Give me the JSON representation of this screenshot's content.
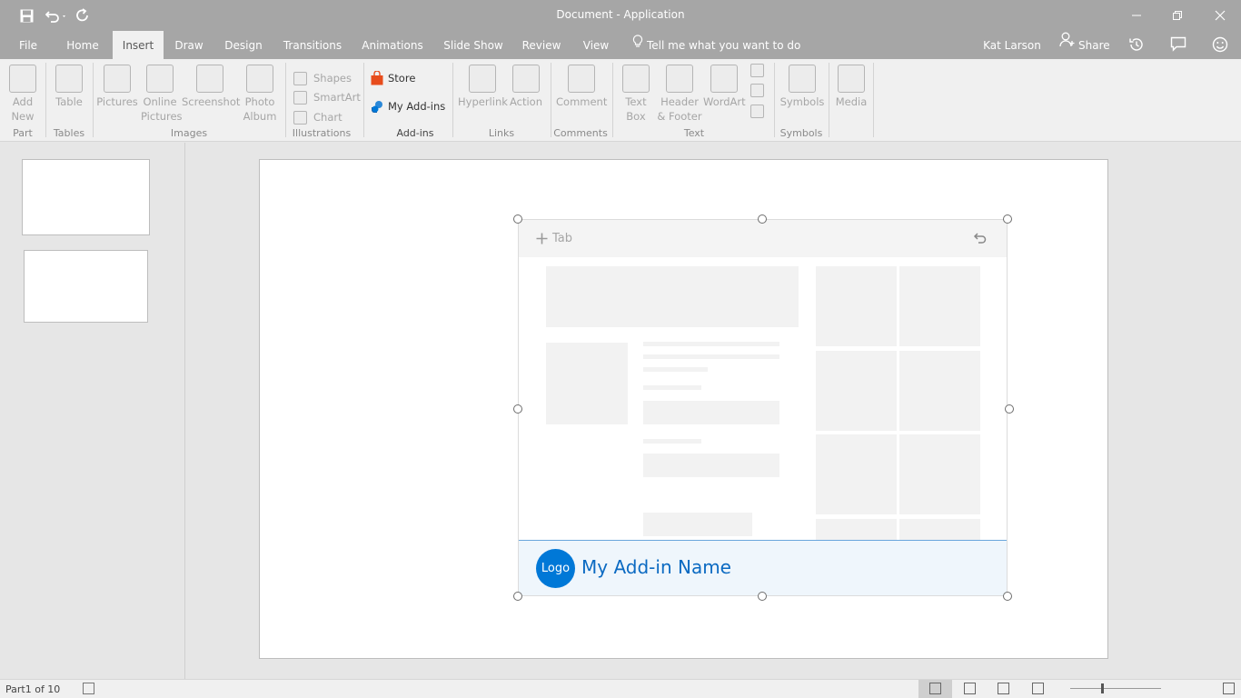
{
  "window": {
    "title": "Document - Application",
    "user": "Kat Larson",
    "share_label": "Share"
  },
  "tabs": {
    "file": "File",
    "home": "Home",
    "insert": "Insert",
    "draw": "Draw",
    "design": "Design",
    "transitions": "Transitions",
    "animations": "Animations",
    "slideshow": "Slide Show",
    "review": "Review",
    "view": "View",
    "tell_me": "Tell me what you want to do"
  },
  "ribbon": {
    "add_new_1": "Add",
    "add_new_2": "New",
    "group_part": "Part",
    "table": "Table",
    "group_tables": "Tables",
    "pictures": "Pictures",
    "online_1": "Online",
    "online_2": "Pictures",
    "screenshot": "Screenshot",
    "photo_1": "Photo",
    "photo_2": "Album",
    "group_images": "Images",
    "shapes": "Shapes",
    "smartart": "SmartArt",
    "chart": "Chart",
    "group_illustrations": "Illustrations",
    "store": "Store",
    "my_addins": "My Add-ins",
    "group_addins": "Add-ins",
    "hyperlink": "Hyperlink",
    "action": "Action",
    "group_links": "Links",
    "comment": "Comment",
    "group_comments": "Comments",
    "textbox_1": "Text",
    "textbox_2": "Box",
    "header_1": "Header",
    "header_2": "& Footer",
    "wordart": "WordArt",
    "group_text": "Text",
    "symbols": "Symbols",
    "group_symbols": "Symbols",
    "media": "Media"
  },
  "addin": {
    "tab_label": "Tab",
    "logo": "Logo",
    "name": "My Add-in Name"
  },
  "status": {
    "page": "Part1 of 10"
  },
  "colors": {
    "chrome": "#a6a6a6",
    "accent": "#0078d7",
    "addin_footer": "#eff6fc",
    "store_icon": "#e74c1c"
  },
  "icons": [
    "save-icon",
    "undo-icon",
    "redo-icon",
    "lightbulb-icon",
    "person-add-icon",
    "history-icon",
    "comment-icon",
    "smiley-icon",
    "store-bag-icon",
    "my-addins-icon",
    "plus-icon",
    "back-arrow-icon"
  ]
}
